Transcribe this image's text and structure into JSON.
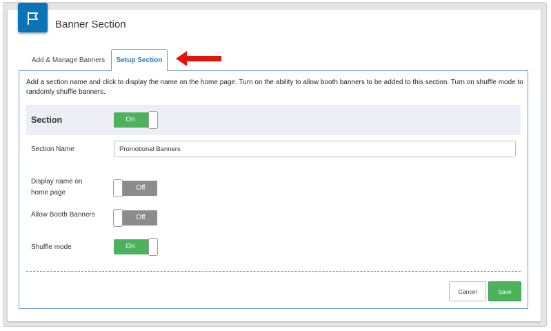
{
  "header": {
    "title": "Banner Section",
    "logo_icon": "flag-icon",
    "logo_color": "#0b73b8"
  },
  "tabs": [
    {
      "label": "Add & Manage Banners",
      "active": false
    },
    {
      "label": "Setup Section",
      "active": true
    }
  ],
  "annotation": {
    "icon": "red-arrow-left-icon",
    "color": "#e8120c"
  },
  "intro_text": "Add a section name and click to display the name on the home page. Turn on the ability to allow booth banners to be added to this section. Turn on shuffle mode to randomly shuffle banners.",
  "section": {
    "label": "Section",
    "toggle": "On"
  },
  "fields": {
    "section_name": {
      "label": "Section Name",
      "value": "Promotional Banners"
    },
    "display_name": {
      "label": "Display name on home page",
      "toggle": "Off"
    },
    "allow_booth": {
      "label": "Allow Booth Banners",
      "toggle": "Off"
    },
    "shuffle": {
      "label": "Shuffle mode",
      "toggle": "On"
    }
  },
  "buttons": {
    "cancel": "Cancel",
    "save": "Save"
  },
  "colors": {
    "toggle_on": "#4cb25c",
    "toggle_off": "#8c8c8c",
    "active_tab": "#1a7bbf"
  }
}
